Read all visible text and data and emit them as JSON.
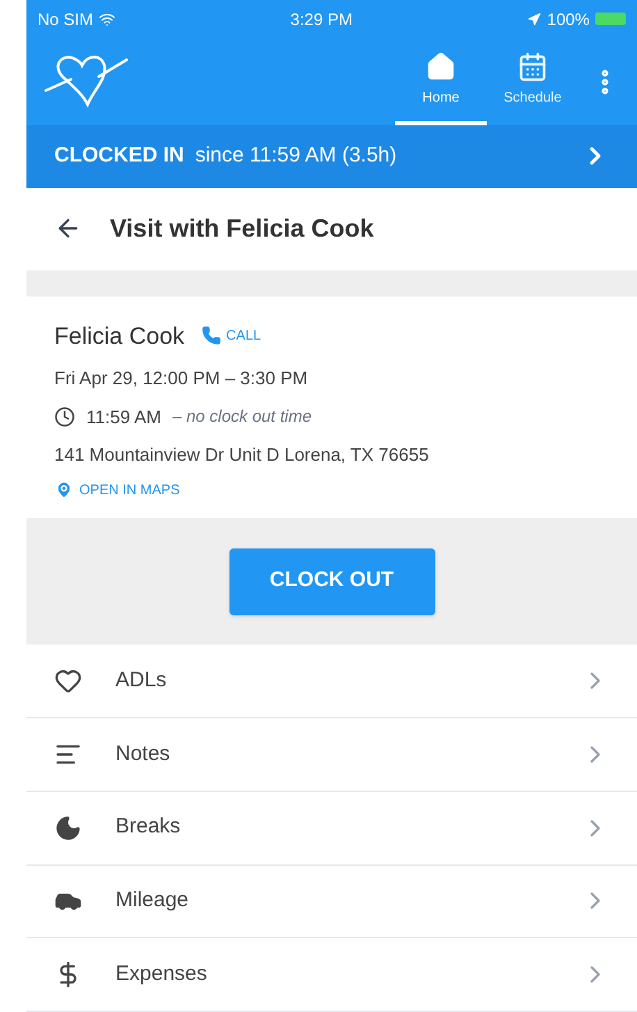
{
  "status_bar": {
    "carrier": "No SIM",
    "time": "3:29 PM",
    "battery": "100%"
  },
  "nav_tabs": [
    {
      "label": "Home",
      "kind": "home",
      "selected": true
    },
    {
      "label": "Schedule",
      "kind": "calendar",
      "selected": false
    }
  ],
  "clock_banner": {
    "status": "CLOCKED IN",
    "detail": "since 11:59 AM (3.5h)"
  },
  "page_title": "Visit with Felicia Cook",
  "visit": {
    "client": "Felicia Cook",
    "call_label": "CALL",
    "date": "Fri Apr 29, 12:00 PM – 3:30 PM",
    "clock_in": "11:59 AM",
    "clock_out_note": "– no clock out time",
    "address": "141 Mountainview Dr Unit D Lorena, TX 76655",
    "maps_label": "OPEN IN MAPS"
  },
  "clock_out_button": "CLOCK OUT",
  "menu_items": [
    {
      "label": "ADLs",
      "kind": "heart"
    },
    {
      "label": "Notes",
      "kind": "notes"
    },
    {
      "label": "Breaks",
      "kind": "moon"
    },
    {
      "label": "Mileage",
      "kind": "car"
    },
    {
      "label": "Expenses",
      "kind": "dollar"
    }
  ]
}
